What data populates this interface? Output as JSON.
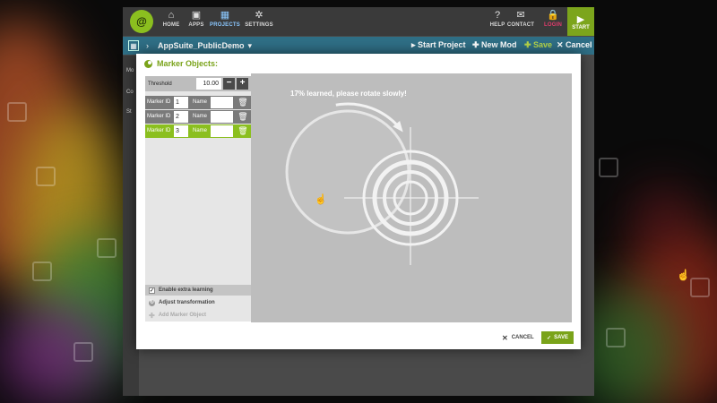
{
  "app": {
    "logo_text": "@",
    "nav": [
      {
        "label": "HOME",
        "icon": "home-icon",
        "glyph": "⌂"
      },
      {
        "label": "APPS",
        "icon": "apps-icon",
        "glyph": "▣"
      },
      {
        "label": "PROJECTS",
        "icon": "projects-icon",
        "glyph": "▦"
      },
      {
        "label": "SETTINGS",
        "icon": "gear-icon",
        "glyph": "✲"
      }
    ],
    "right_nav": [
      {
        "label": "HELP",
        "icon": "help-icon",
        "glyph": "?"
      },
      {
        "label": "CONTACT",
        "icon": "mail-icon",
        "glyph": "✉"
      },
      {
        "label": "LOGIN",
        "icon": "lock-icon",
        "glyph": "🔒"
      }
    ],
    "start_label": "START",
    "start_glyph": "▶",
    "accent_color": "#8bbf1f",
    "subbar_color": "#2f6f86"
  },
  "subbar": {
    "project_name": "AppSuite_PublicDemo",
    "dropdown_glyph": "▾",
    "start_project": "▸ Start Project",
    "new_mod": "✚ New Mod",
    "save": "✚ Save",
    "cancel": "✕ Cancel"
  },
  "leftstrip": {
    "items": [
      "Mo",
      "Co",
      "St"
    ]
  },
  "modal": {
    "title": "Marker Objects:",
    "threshold_label": "Threshold",
    "threshold_value": "10.00",
    "minus": "−",
    "plus": "+",
    "markers": [
      {
        "id_label": "Marker ID",
        "id_value": "1",
        "name_label": "Name",
        "selected": false
      },
      {
        "id_label": "Marker ID",
        "id_value": "2",
        "name_label": "Name",
        "selected": false
      },
      {
        "id_label": "Marker ID",
        "id_value": "3",
        "name_label": "Name",
        "selected": true
      }
    ],
    "trash_glyph": "🗑",
    "options": {
      "extra_learning": "Enable extra learning",
      "adjust_transformation": "Adjust transformation",
      "add_marker": "Add Marker Object"
    },
    "progress_text": "17% learned, please rotate slowly!",
    "progress_fraction": 0.17,
    "cancel_label": "CANCEL",
    "save_label": "SAVE"
  }
}
